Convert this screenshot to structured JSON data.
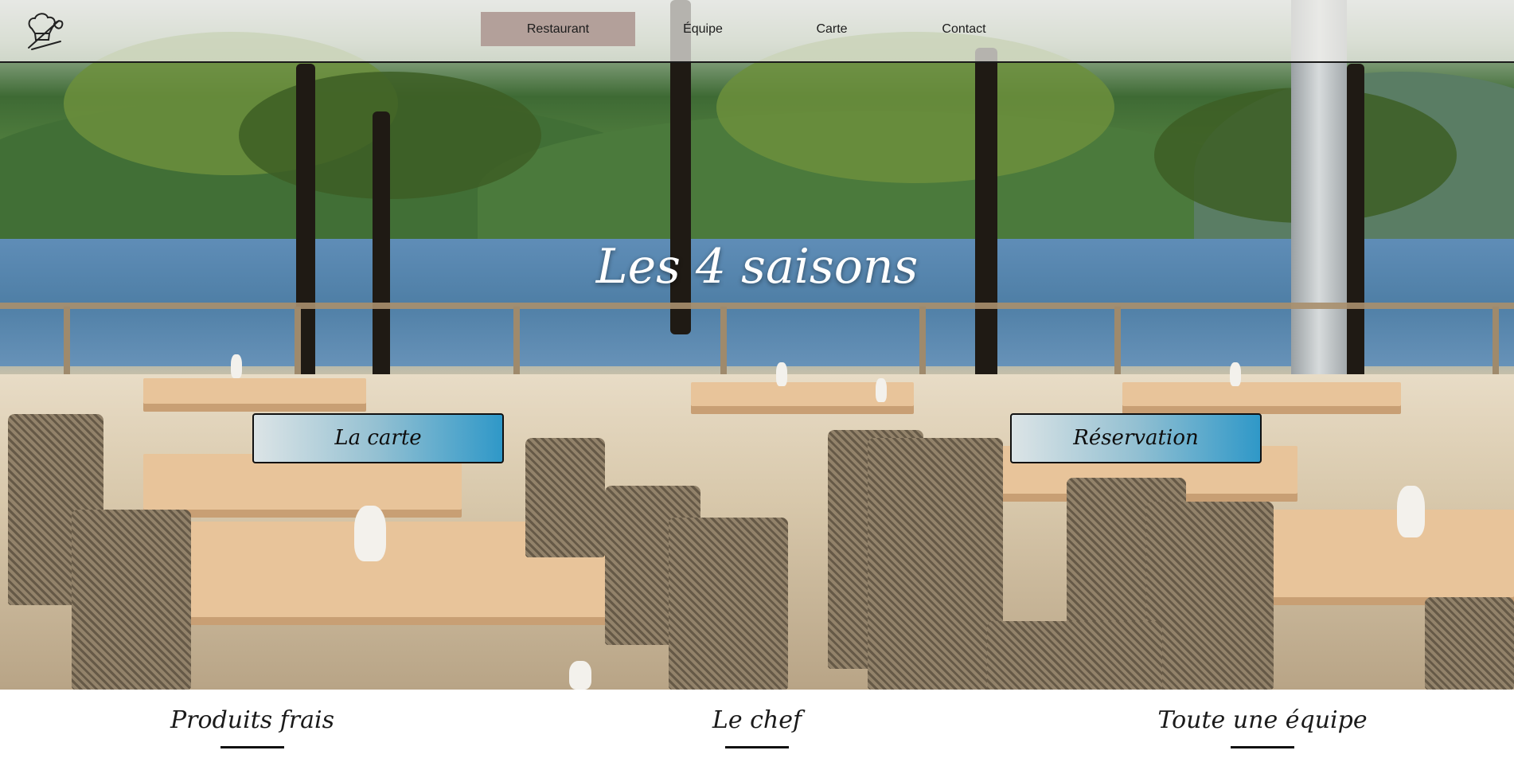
{
  "nav": {
    "logo_icon": "chef-hat-whisk-icon",
    "items": [
      {
        "label": "Restaurant",
        "active": true
      },
      {
        "label": "Équipe",
        "active": false
      },
      {
        "label": "Carte",
        "active": false
      },
      {
        "label": "Contact",
        "active": false
      }
    ],
    "active_color": "#b3a09a"
  },
  "hero": {
    "title": "Les 4 saisons",
    "buttons": {
      "menu_label": "La carte",
      "reservation_label": "Réservation"
    }
  },
  "features": [
    {
      "title": "Produits frais"
    },
    {
      "title": "Le chef"
    },
    {
      "title": "Toute une équipe"
    }
  ]
}
